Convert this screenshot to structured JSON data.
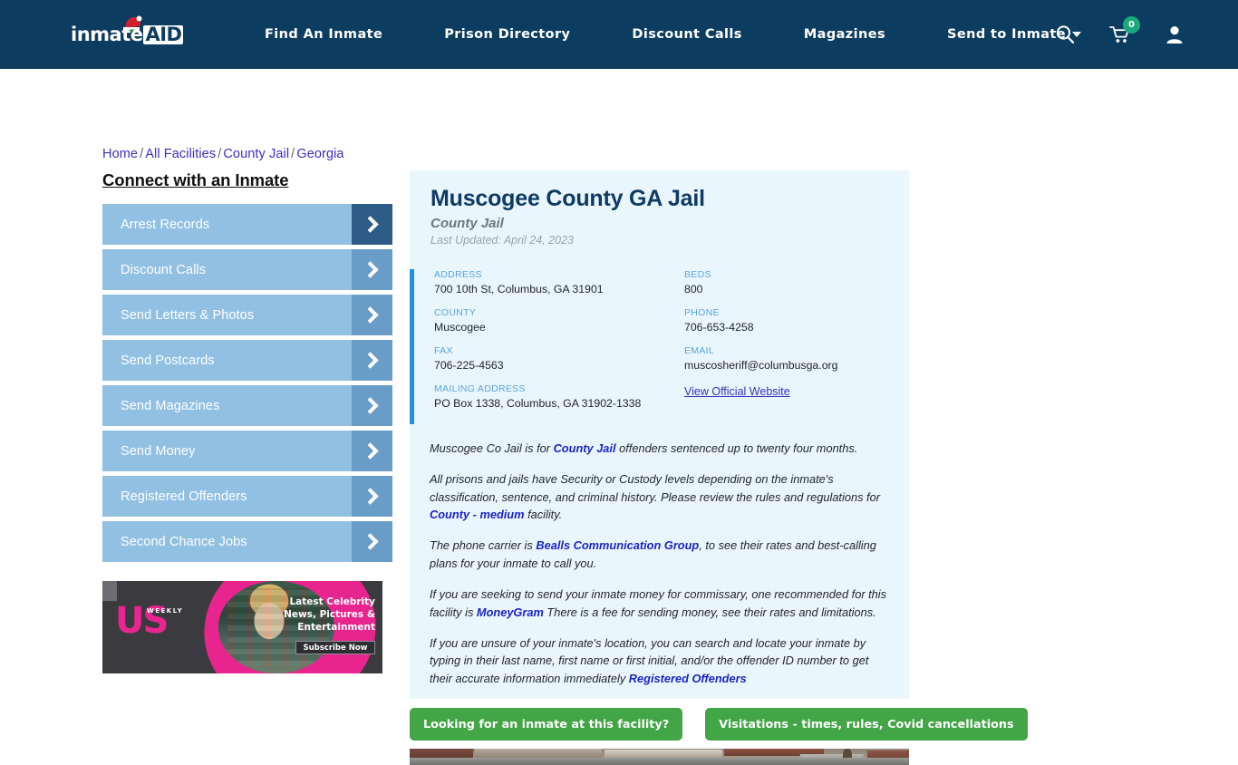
{
  "header": {
    "logo": {
      "part1": "inmate",
      "part2": "AID",
      "icon": "santa-hat-icon"
    },
    "nav": [
      {
        "label": "Find An Inmate"
      },
      {
        "label": "Prison Directory"
      },
      {
        "label": "Discount Calls"
      },
      {
        "label": "Magazines"
      },
      {
        "label": "Send to Inmate",
        "has_dropdown": true
      }
    ],
    "icons": {
      "search": "search-icon",
      "cart": "cart-icon",
      "cart_count": "0",
      "account": "user-account-icon"
    },
    "colors": {
      "background": "#0d3c61",
      "badge": "#1aa97c"
    }
  },
  "breadcrumb": {
    "items": [
      "Home",
      "All Facilities",
      "County Jail",
      "Georgia"
    ],
    "separator": "/"
  },
  "sidebar": {
    "title": "Connect with an Inmate",
    "items": [
      {
        "label": "Arrest Records",
        "active": true
      },
      {
        "label": "Discount Calls",
        "active": false
      },
      {
        "label": "Send Letters & Photos",
        "active": false
      },
      {
        "label": "Send Postcards",
        "active": false
      },
      {
        "label": "Send Magazines",
        "active": false
      },
      {
        "label": "Send Money",
        "active": false
      },
      {
        "label": "Registered Offenders",
        "active": false
      },
      {
        "label": "Second Chance Jobs",
        "active": false
      }
    ]
  },
  "ad": {
    "brand": "US",
    "brand_sub": "WEEKLY",
    "line1": "Latest Celebrity",
    "line2": "News, Pictures &",
    "line3": "Entertainment",
    "cta": "Subscribe Now"
  },
  "facility": {
    "title": "Muscogee County GA Jail",
    "type": "County Jail",
    "last_updated": "Last Updated: April 24, 2023",
    "info": [
      {
        "label": "ADDRESS",
        "value": "700 10th St, Columbus, GA 31901"
      },
      {
        "label": "BEDS",
        "value": "800"
      },
      {
        "label": "COUNTY",
        "value": "Muscogee"
      },
      {
        "label": "PHONE",
        "value": "706-653-4258"
      },
      {
        "label": "FAX",
        "value": "706-225-4563"
      },
      {
        "label": "EMAIL",
        "value": "muscosheriff@columbusga.org"
      },
      {
        "label": "MAILING ADDRESS",
        "value": "PO Box 1338, Columbus, GA 31902-1338"
      }
    ],
    "website_link": "View Official Website"
  },
  "description": {
    "p1_a": "Muscogee Co Jail is for ",
    "p1_link": "County Jail",
    "p1_b": " offenders sentenced up to twenty four months.",
    "p2_a": "All prisons and jails have Security or Custody levels depending on the inmate's classification, sentence, and criminal history. Please review the rules and regulations for ",
    "p2_link": "County - medium",
    "p2_b": " facility.",
    "p3_a": "The phone carrier is ",
    "p3_link": "Bealls Communication Group",
    "p3_b": ", to see their rates and best-calling plans for your inmate to call you.",
    "p4_a": "If you are seeking to send your inmate money for commissary, one recommended for this facility is ",
    "p4_link": "MoneyGram",
    "p4_b": " There is a fee for sending money, see their rates and limitations.",
    "p5_a": "If you are unsure of your inmate's location, you can search and locate your inmate by typing in their last name, first name or first initial, and/or the offender ID number to get their accurate information immediately ",
    "p5_link": "Registered Offenders",
    "p5_b": ""
  },
  "actions": {
    "inmate_search": "Looking for an inmate at this facility?",
    "visitations": "Visitations - times, rules, Covid cancellations",
    "color": "#42a546"
  },
  "photo": {
    "alt": "aerial-facility-photo"
  }
}
